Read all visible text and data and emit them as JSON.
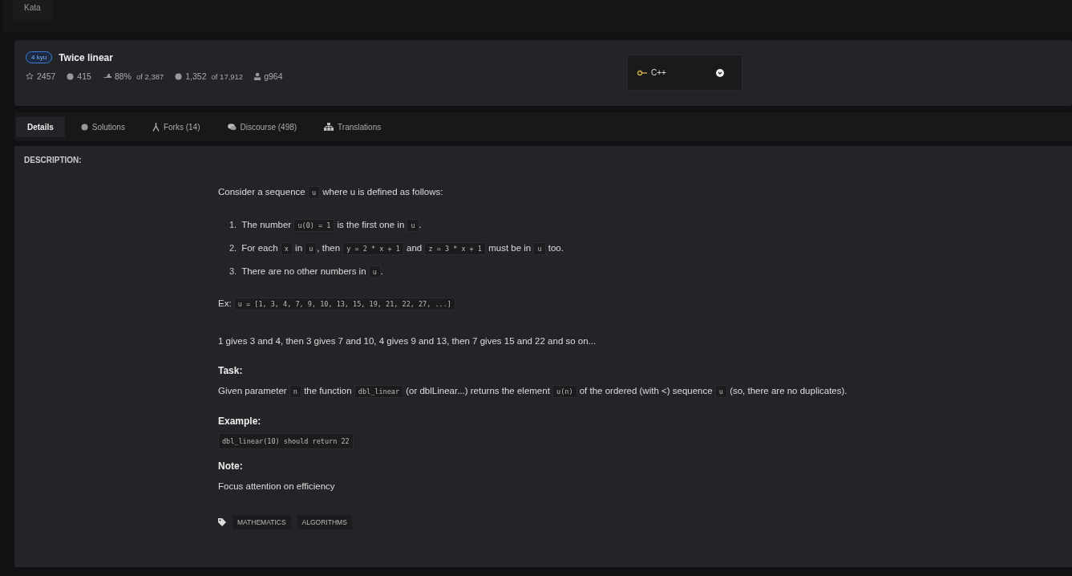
{
  "top_tab": "Kata",
  "kata": {
    "rank": "4 kyu",
    "title": "Twice linear",
    "stats": [
      {
        "kind": "stars",
        "text": "2457"
      },
      {
        "kind": "collections",
        "text": "415"
      },
      {
        "kind": "satisfaction",
        "text": "88%",
        "suffix": "of 2,387"
      },
      {
        "kind": "completed",
        "text": "1,352",
        "suffix": "of 17,912"
      },
      {
        "kind": "author",
        "text": "g964"
      }
    ]
  },
  "language": {
    "label": "C++"
  },
  "tabs": [
    {
      "label": "Details",
      "kind": "details",
      "selected": true
    },
    {
      "label": "Solutions",
      "kind": "solutions",
      "selected": false
    },
    {
      "label": "Forks (14)",
      "kind": "forks",
      "selected": false
    },
    {
      "label": "Discourse (498)",
      "kind": "discourse",
      "selected": false
    },
    {
      "label": "Translations",
      "kind": "translations",
      "selected": false
    }
  ],
  "description": {
    "heading": "DESCRIPTION:",
    "blocks": [
      {
        "kind": "paragraph",
        "parts": [
          {
            "kind": "text",
            "text": "Consider a sequence "
          },
          {
            "kind": "code",
            "text": "u"
          },
          {
            "kind": "text",
            "text": " where u is defined as follows:"
          }
        ]
      },
      {
        "kind": "list",
        "items": [
          {
            "number": "1.",
            "parts": [
              {
                "kind": "text",
                "text": "The number "
              },
              {
                "kind": "code",
                "text": "u(0) = 1"
              },
              {
                "kind": "text",
                "text": " is the first one in "
              },
              {
                "kind": "code",
                "text": "u"
              },
              {
                "kind": "text",
                "text": "."
              }
            ]
          },
          {
            "number": "2.",
            "parts": [
              {
                "kind": "text",
                "text": "For each "
              },
              {
                "kind": "code",
                "text": "x"
              },
              {
                "kind": "text",
                "text": " in "
              },
              {
                "kind": "code",
                "text": "u"
              },
              {
                "kind": "text",
                "text": ", then "
              },
              {
                "kind": "code",
                "text": "y = 2 * x + 1"
              },
              {
                "kind": "text",
                "text": " and "
              },
              {
                "kind": "code",
                "text": "z = 3 * x + 1"
              },
              {
                "kind": "text",
                "text": " must be in "
              },
              {
                "kind": "code",
                "text": "u"
              },
              {
                "kind": "text",
                "text": " too."
              }
            ]
          },
          {
            "number": "3.",
            "parts": [
              {
                "kind": "text",
                "text": "There are no other numbers in "
              },
              {
                "kind": "code",
                "text": "u"
              },
              {
                "kind": "text",
                "text": "."
              }
            ]
          }
        ]
      },
      {
        "kind": "paragraph",
        "parts": [
          {
            "kind": "text",
            "text": "Ex: "
          },
          {
            "kind": "code",
            "text": "u = [1, 3, 4, 7, 9, 10, 13, 15, 19, 21, 22, 27, ...]"
          }
        ]
      },
      {
        "kind": "paragraph",
        "parts": [
          {
            "kind": "text",
            "text": "1 gives 3 and 4, then 3 gives 7 and 10, 4 gives 9 and 13, then 7 gives 15 and 22 and so on..."
          }
        ]
      },
      {
        "kind": "heading",
        "text": "Task:"
      },
      {
        "kind": "paragraph",
        "parts": [
          {
            "kind": "text",
            "text": "Given parameter "
          },
          {
            "kind": "code",
            "text": "n"
          },
          {
            "kind": "text",
            "text": " the function "
          },
          {
            "kind": "code",
            "text": "dbl_linear"
          },
          {
            "kind": "text",
            "text": " (or dblLinear...) returns the element "
          },
          {
            "kind": "code",
            "text": "u(n)"
          },
          {
            "kind": "text",
            "text": " of the ordered (with <) sequence "
          },
          {
            "kind": "code",
            "text": "u"
          },
          {
            "kind": "text",
            "text": " (so, there are no duplicates)."
          }
        ]
      },
      {
        "kind": "heading",
        "text": "Example:"
      },
      {
        "kind": "code_block",
        "text": "dbl_linear(10) should return 22"
      },
      {
        "kind": "heading",
        "text": "Note:"
      },
      {
        "kind": "paragraph",
        "parts": [
          {
            "kind": "text",
            "text": "Focus attention on efficiency"
          }
        ]
      }
    ],
    "tags": [
      "MATHEMATICS",
      "ALGORITHMS"
    ]
  }
}
